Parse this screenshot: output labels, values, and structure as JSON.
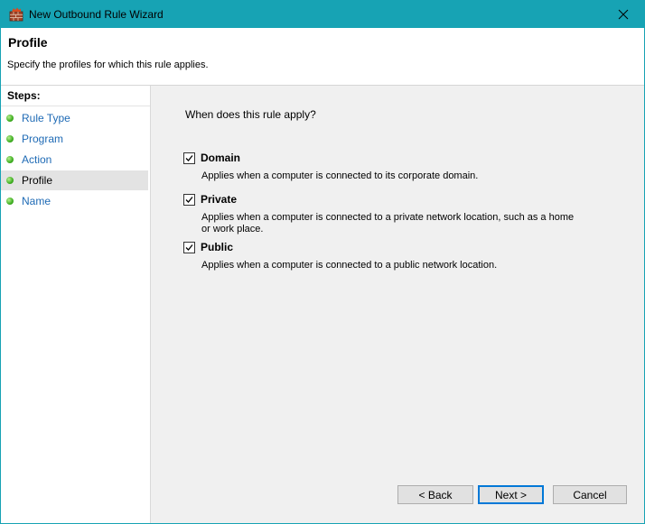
{
  "window": {
    "title": "New Outbound Rule Wizard"
  },
  "header": {
    "title": "Profile",
    "description": "Specify the profiles for which this rule applies."
  },
  "steps": {
    "heading": "Steps:",
    "items": [
      {
        "label": "Rule Type"
      },
      {
        "label": "Program"
      },
      {
        "label": "Action"
      },
      {
        "label": "Profile",
        "active": true
      },
      {
        "label": "Name"
      }
    ]
  },
  "content": {
    "question": "When does this rule apply?",
    "options": [
      {
        "title": "Domain",
        "checked": true,
        "desc_lines": [
          "Applies when a computer is connected to its corporate domain."
        ]
      },
      {
        "title": "Private",
        "checked": true,
        "desc_lines": [
          "Applies when a computer is connected to a private network location, such as a home",
          "or work place."
        ]
      },
      {
        "title": "Public",
        "checked": true,
        "desc_lines": [
          "Applies when a computer is connected to a public network location."
        ]
      }
    ]
  },
  "buttons": {
    "back": "< Back",
    "next": "Next >",
    "cancel": "Cancel"
  },
  "colors": {
    "titlebar": "#17a3b4",
    "step_link": "#1e6ab5",
    "default_button_border": "#0078d7"
  },
  "icons": {
    "app": "firewall-brick-icon",
    "close": "close-icon",
    "step": "green-dot-icon",
    "check": "checkmark-icon"
  }
}
